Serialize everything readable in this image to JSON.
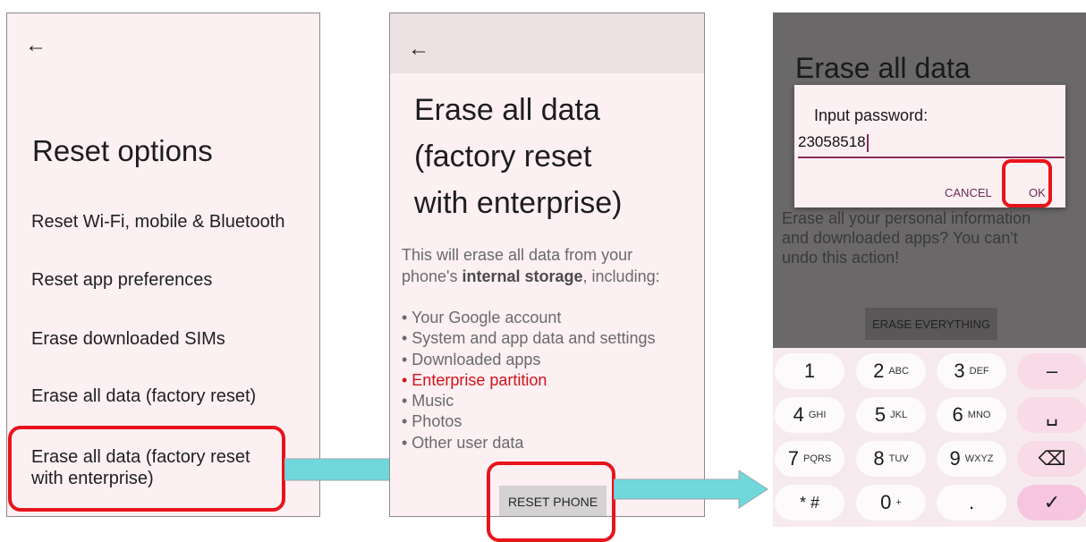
{
  "panel1": {
    "back_icon": "arrow-left-icon",
    "title": "Reset options",
    "items": [
      {
        "label": "Reset Wi-Fi, mobile & Bluetooth"
      },
      {
        "label": "Reset app preferences"
      },
      {
        "label": "Erase downloaded SIMs"
      },
      {
        "label": "Erase all data (factory reset)"
      },
      {
        "label_line1": "Erase all data (factory reset",
        "label_line2": "with enterprise)"
      }
    ]
  },
  "panel2": {
    "back_icon": "arrow-left-icon",
    "title_lines": [
      "Erase all data",
      "(factory reset",
      "with enterprise)"
    ],
    "desc_line1": "This will erase all data from your",
    "desc_line2_pre": "phone's ",
    "desc_line2_bold": "internal storage",
    "desc_line2_post": ", including:",
    "bullets": [
      "• Your Google account",
      "• System and app data and settings",
      "• Downloaded apps",
      "• Enterprise partition",
      "• Music",
      "• Photos",
      "• Other user data"
    ],
    "reset_button": "RESET PHONE"
  },
  "panel3": {
    "title": "Erase all data",
    "desc_line1": "Erase all your personal information",
    "desc_line2": "and downloaded apps? You can't",
    "desc_line3": "undo this action!",
    "erase_button": "ERASE EVERYTHING",
    "dialog": {
      "title": "Input password:",
      "value": "23058518",
      "cancel": "CANCEL",
      "ok": "OK"
    },
    "keypad": {
      "rows": [
        [
          {
            "main": "1",
            "sub": ""
          },
          {
            "main": "2",
            "sub": "ABC"
          },
          {
            "main": "3",
            "sub": "DEF"
          },
          {
            "main": "–",
            "sub": ""
          }
        ],
        [
          {
            "main": "4",
            "sub": "GHI"
          },
          {
            "main": "5",
            "sub": "JKL"
          },
          {
            "main": "6",
            "sub": "MNO"
          },
          {
            "main": "␣",
            "sub": ""
          }
        ],
        [
          {
            "main": "7",
            "sub": "PQRS"
          },
          {
            "main": "8",
            "sub": "TUV"
          },
          {
            "main": "9",
            "sub": "WXYZ"
          },
          {
            "main": "⌫",
            "sub": ""
          }
        ],
        [
          {
            "main": "* #",
            "sub": ""
          },
          {
            "main": "0",
            "sub": "+"
          },
          {
            "main": ".",
            "sub": ""
          },
          {
            "main": "✓",
            "sub": ""
          }
        ]
      ]
    }
  },
  "colors": {
    "highlight": "#e8141b",
    "arrow": "#6fd8dc",
    "screen_bg": "#fcf0f3",
    "red_text": "#d0131b"
  }
}
